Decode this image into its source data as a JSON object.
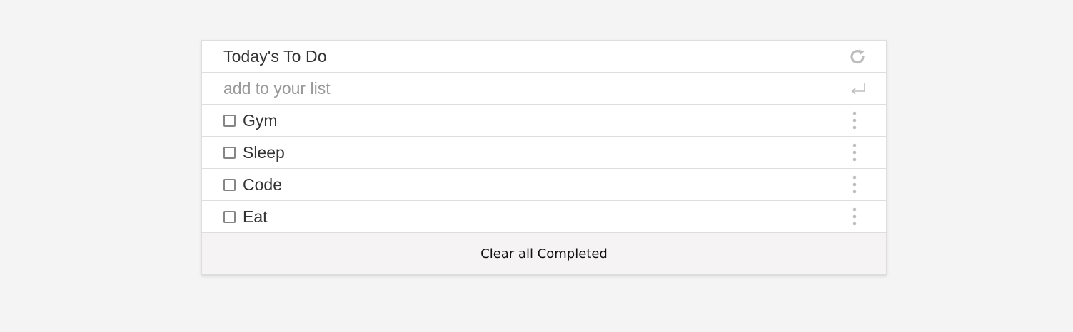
{
  "header": {
    "title": "Today's To Do",
    "reset_icon": "refresh-icon"
  },
  "add": {
    "placeholder": "add to your list",
    "value": "",
    "submit_icon": "enter-arrow-icon"
  },
  "items": [
    {
      "label": "Gym",
      "completed": false
    },
    {
      "label": "Sleep",
      "completed": false
    },
    {
      "label": "Code",
      "completed": false
    },
    {
      "label": "Eat",
      "completed": false
    }
  ],
  "footer": {
    "clear_label": "Clear all Completed"
  },
  "colors": {
    "page_background": "#f4f4f4",
    "card_background": "#ffffff",
    "footer_background": "#f5f3f3",
    "text": "#333333",
    "placeholder": "#9a9a9a",
    "icon": "#bdbdbd",
    "border": "#dedede"
  }
}
